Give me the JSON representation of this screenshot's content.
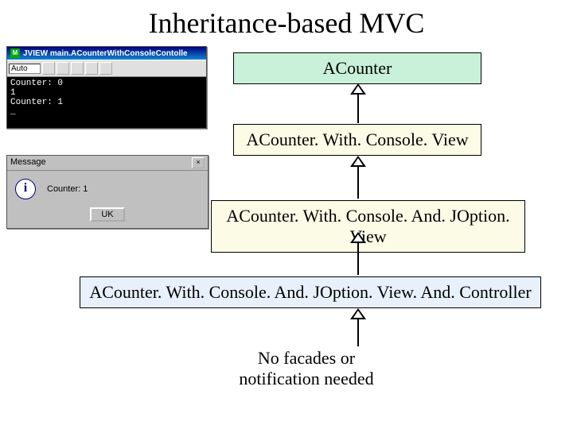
{
  "title": "Inheritance-based MVC",
  "hierarchy": {
    "level0": "ACounter",
    "level1": "ACounter. With. Console. View",
    "level2": "ACounter. With. Console. And. JOption. View",
    "level3": "ACounter. With. Console. And. JOption. View. And. Controller"
  },
  "caption_line1": "No facades or",
  "caption_line2": "notification  needed",
  "console": {
    "title": "JVIEW main.ACounterWithConsoleContolle",
    "combo": "Auto",
    "body": "Counter: 0\n1\nCounter: 1\n_"
  },
  "dialog": {
    "title": "Message",
    "text": "Counter: 1",
    "button": "UK"
  },
  "chart_data": {
    "type": "hierarchy",
    "title": "Inheritance-based MVC",
    "nodes": [
      {
        "id": "ACounter",
        "label": "ACounter"
      },
      {
        "id": "ACounterWithConsoleView",
        "label": "ACounter.With.Console.View",
        "extends": "ACounter"
      },
      {
        "id": "ACounterWithConsoleAndJOptionView",
        "label": "ACounter.With.Console.And.JOption.View",
        "extends": "ACounterWithConsoleView"
      },
      {
        "id": "ACounterWithConsoleAndJOptionViewAndController",
        "label": "ACounter.With.Console.And.JOption.View.And.Controller",
        "extends": "ACounterWithConsoleAndJOptionView"
      }
    ],
    "annotation": "No facades or notification needed"
  }
}
